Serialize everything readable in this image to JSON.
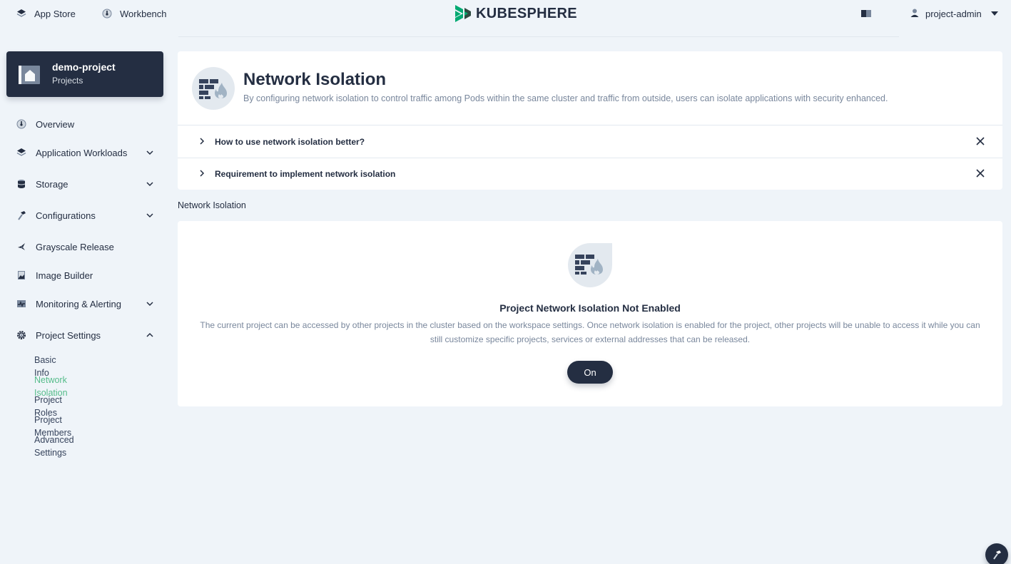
{
  "topbar": {
    "app_store_label": "App Store",
    "workbench_label": "Workbench",
    "logo_text": "KUBESPHERE",
    "user_label": "project-admin"
  },
  "project": {
    "name": "demo-project",
    "type": "Projects"
  },
  "sidebar": {
    "items": [
      {
        "label": "Overview",
        "icon": "dashboard-icon",
        "expandable": false
      },
      {
        "label": "Application Workloads",
        "icon": "appcenter-icon",
        "expandable": true
      },
      {
        "label": "Storage",
        "icon": "database-icon",
        "expandable": true
      },
      {
        "label": "Configurations",
        "icon": "hammer-icon",
        "expandable": true
      },
      {
        "label": "Grayscale Release",
        "icon": "bird-icon",
        "expandable": false
      },
      {
        "label": "Image Builder",
        "icon": "image-icon",
        "expandable": false
      },
      {
        "label": "Monitoring & Alerting",
        "icon": "monitor-icon",
        "expandable": true
      },
      {
        "label": "Project Settings",
        "icon": "gear-icon",
        "expandable": true,
        "expanded": true
      }
    ],
    "sub_items": [
      {
        "label": "Basic Info",
        "active": false
      },
      {
        "label": "Network Isolation",
        "active": true
      },
      {
        "label": "Project Roles",
        "active": false
      },
      {
        "label": "Project Members",
        "active": false
      },
      {
        "label": "Advanced Settings",
        "active": false
      }
    ]
  },
  "banner": {
    "title": "Network Isolation",
    "description": "By configuring network isolation to control traffic among Pods within the same cluster and traffic from outside, users can isolate applications with security enhanced."
  },
  "tips": [
    {
      "label": "How to use network isolation better?"
    },
    {
      "label": "Requirement to implement network isolation"
    }
  ],
  "section": {
    "title": "Network Isolation"
  },
  "empty_state": {
    "title": "Project Network Isolation Not Enabled",
    "description": "The current project can be accessed by other projects in the cluster based on the workspace settings. Once network isolation is enabled for the project, other projects will be unable to access it while you can still customize specific projects, services or external addresses that can be released.",
    "button_label": "On"
  },
  "colors": {
    "accent": "#55bc8a",
    "dark": "#242e42",
    "background": "#eff4f9"
  }
}
